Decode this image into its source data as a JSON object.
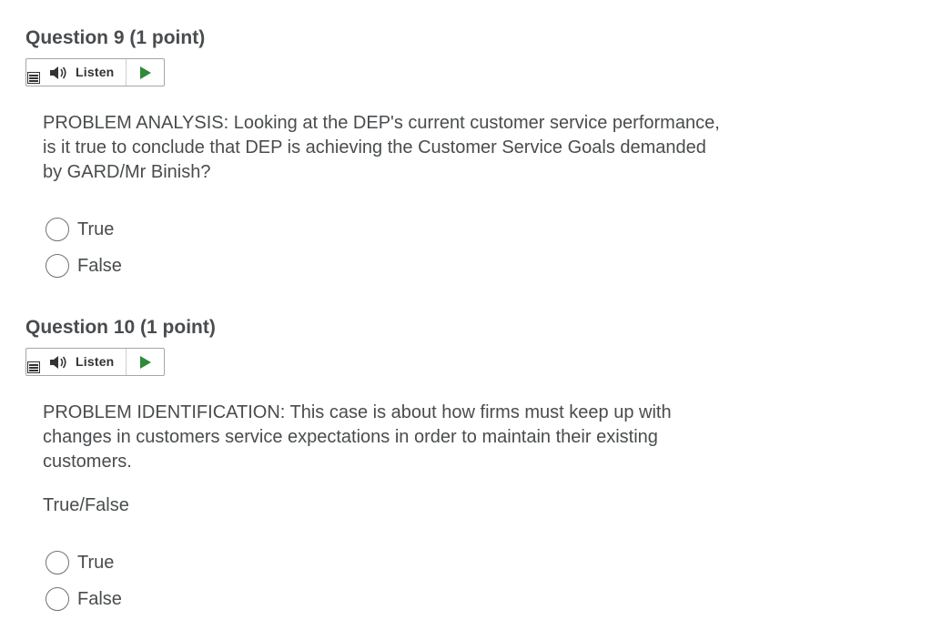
{
  "questions": [
    {
      "title": "Question 9",
      "points": "(1 point)",
      "listen_label": "Listen",
      "prompt_lines": [
        "PROBLEM ANALYSIS:  Looking at the DEP's current customer service performance,",
        "is it true to conclude that  DEP is achieving the Customer Service Goals demanded",
        "by GARD/Mr Binish?"
      ],
      "options": [
        "True",
        "False"
      ]
    },
    {
      "title": "Question 10",
      "points": "(1 point)",
      "listen_label": "Listen",
      "prompt_lines": [
        "PROBLEM IDENTIFICATION: This case is about how firms must keep  up with",
        "changes  in customers service expectations in order to  maintain their existing",
        "customers."
      ],
      "extra_line": "True/False",
      "options": [
        "True",
        "False"
      ]
    }
  ],
  "colors": {
    "text": "#494c4e",
    "play": "#2e8b3a",
    "border": "#a6a6a6"
  },
  "icons": [
    "menu-icon",
    "speaker-icon",
    "play-icon"
  ]
}
